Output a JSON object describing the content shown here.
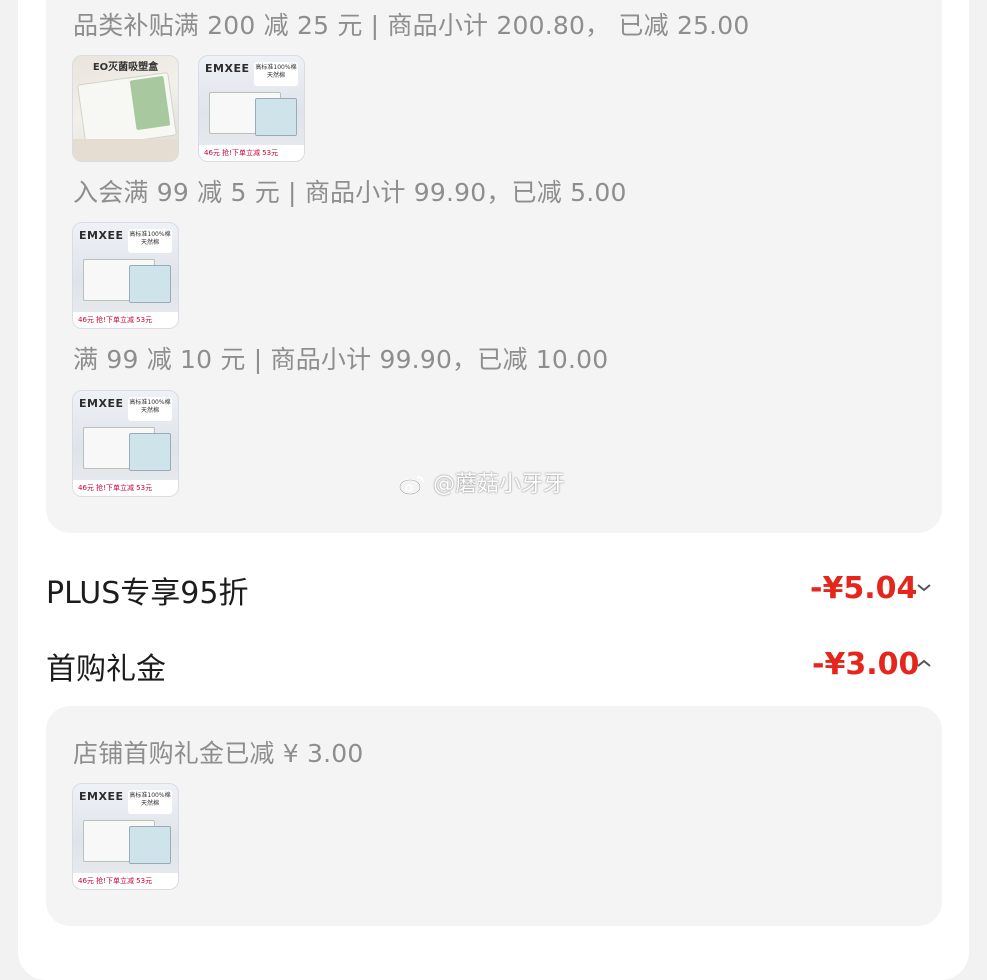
{
  "promotions": [
    {
      "text": "品类补贴满 200 减 25 元 | 商品小计 200.80， 已减 25.00"
    },
    {
      "text": "入会满 99 减 5 元 | 商品小计 99.90，已减 5.00"
    },
    {
      "text": "满 99 减 10 元 | 商品小计 99.90，已减 10.00"
    }
  ],
  "thumbs": {
    "emx_logo": "EMXEE",
    "emx_tag": "高标准100%棉 天然棉",
    "emx_bar": "46元 抢!下单立减 53元",
    "eo_title": "EO灭菌吸塑盒"
  },
  "plus_discount": {
    "label": "PLUS专享95折",
    "value": "-¥5.04"
  },
  "first_purchase": {
    "label": "首购礼金",
    "value": "-¥3.00"
  },
  "gift_detail": {
    "text": "店铺首购礼金已减 ¥ 3.00"
  },
  "watermark": {
    "text": "@蘑菇小牙牙"
  },
  "colors": {
    "accent_red": "#e5261d"
  }
}
